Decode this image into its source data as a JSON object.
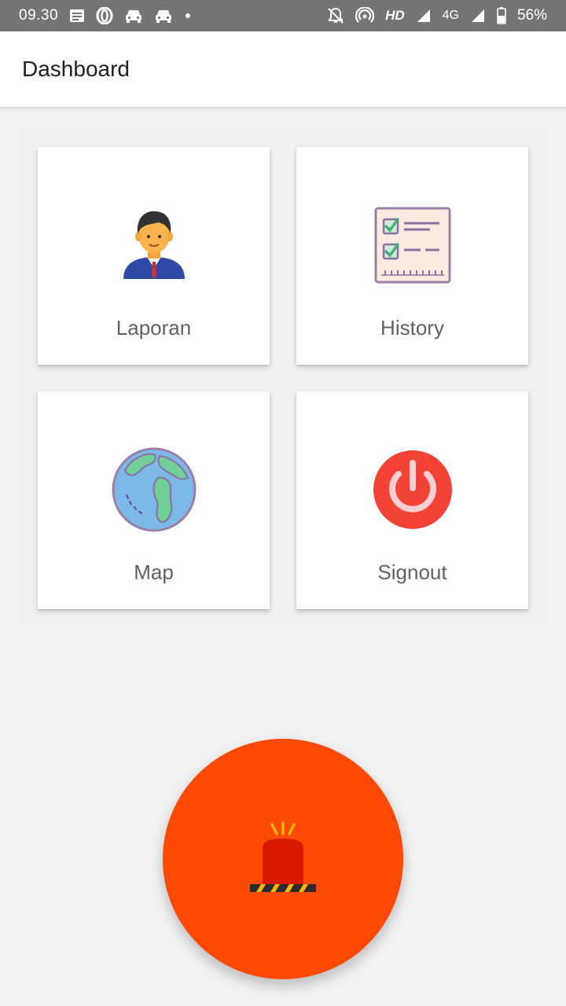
{
  "status_bar": {
    "time": "09.30",
    "network_label": "HD",
    "network_type": "4G",
    "battery": "56%",
    "icons": [
      "notes-icon",
      "opera-icon",
      "car-icon",
      "car-icon",
      "dot-icon",
      "mute-icon",
      "hotspot-icon",
      "signal-icon",
      "signal-icon",
      "battery-icon"
    ]
  },
  "app_bar": {
    "title": "Dashboard"
  },
  "menu": {
    "items": [
      {
        "label": "Laporan",
        "icon": "businessman-icon"
      },
      {
        "label": "History",
        "icon": "checklist-icon"
      },
      {
        "label": "Map",
        "icon": "globe-icon"
      },
      {
        "label": "Signout",
        "icon": "power-icon"
      }
    ]
  },
  "alarm": {
    "icon": "siren-icon",
    "color": "#fe4a04"
  },
  "colors": {
    "status_bar": "#757575",
    "background": "#f1f1f1",
    "card": "#ffffff",
    "label": "#616161"
  }
}
